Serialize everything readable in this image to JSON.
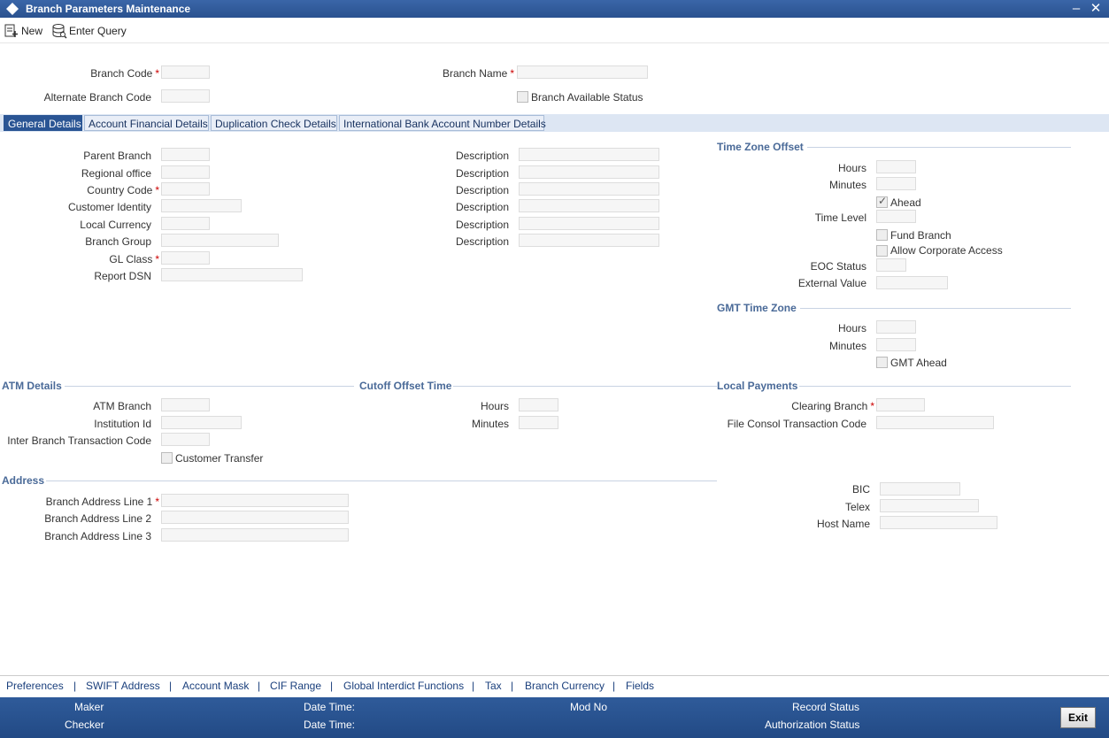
{
  "window": {
    "title": "Branch Parameters Maintenance",
    "minimize": "–",
    "close": "✕"
  },
  "toolbar": {
    "new_label": "New",
    "enter_query_label": "Enter Query"
  },
  "header": {
    "branch_code": "Branch Code",
    "alternate_branch_code": "Alternate Branch Code",
    "branch_name": "Branch Name",
    "branch_available_status": "Branch Available Status"
  },
  "tabs": [
    {
      "label": "General Details",
      "active": true
    },
    {
      "label": "Account Financial Details"
    },
    {
      "label": "Duplication Check Details"
    },
    {
      "label": "International Bank Account Number Details"
    }
  ],
  "general": {
    "left_labels": [
      "Parent Branch",
      "Regional office",
      "Country Code",
      "Customer Identity",
      "Local Currency",
      "Branch Group",
      "GL Class",
      "Report DSN"
    ],
    "description_label": "Description"
  },
  "time_zone": {
    "title": "Time Zone Offset",
    "hours": "Hours",
    "minutes": "Minutes",
    "ahead": "Ahead",
    "time_level": "Time Level",
    "fund_branch": "Fund Branch",
    "allow_corporate_access": "Allow Corporate Access",
    "eoc_status": "EOC Status",
    "external_value": "External Value"
  },
  "gmt": {
    "title": "GMT Time Zone",
    "hours": "Hours",
    "minutes": "Minutes",
    "gmt_ahead": "GMT Ahead"
  },
  "atm": {
    "title": "ATM Details",
    "atm_branch": "ATM Branch",
    "institution_id": "Institution Id",
    "inter_branch_txn_code": "Inter Branch Transaction Code",
    "customer_transfer": "Customer Transfer"
  },
  "cutoff": {
    "title": "Cutoff Offset Time",
    "hours": "Hours",
    "minutes": "Minutes"
  },
  "local_payments": {
    "title": "Local Payments",
    "clearing_branch": "Clearing Branch",
    "file_consol_txn_code": "File Consol Transaction Code"
  },
  "address": {
    "title": "Address",
    "line1": "Branch Address Line 1",
    "line2": "Branch Address Line 2",
    "line3": "Branch Address Line 3"
  },
  "comm": {
    "bic": "BIC",
    "telex": "Telex",
    "host_name": "Host Name"
  },
  "links": [
    "Preferences",
    "SWIFT Address",
    "Account Mask",
    "CIF Range",
    "Global Interdict Functions",
    "Tax",
    "Branch Currency",
    "Fields"
  ],
  "link_separator": "|",
  "footer": {
    "maker": "Maker",
    "checker": "Checker",
    "date_time": "Date Time:",
    "mod_no": "Mod No",
    "record_status": "Record Status",
    "authorization_status": "Authorization Status",
    "exit": "Exit"
  },
  "colors": {
    "title_bar": "#2a528f",
    "tab_active": "#2a5594",
    "section_title": "#4a6a98",
    "required": "#cc0000"
  }
}
